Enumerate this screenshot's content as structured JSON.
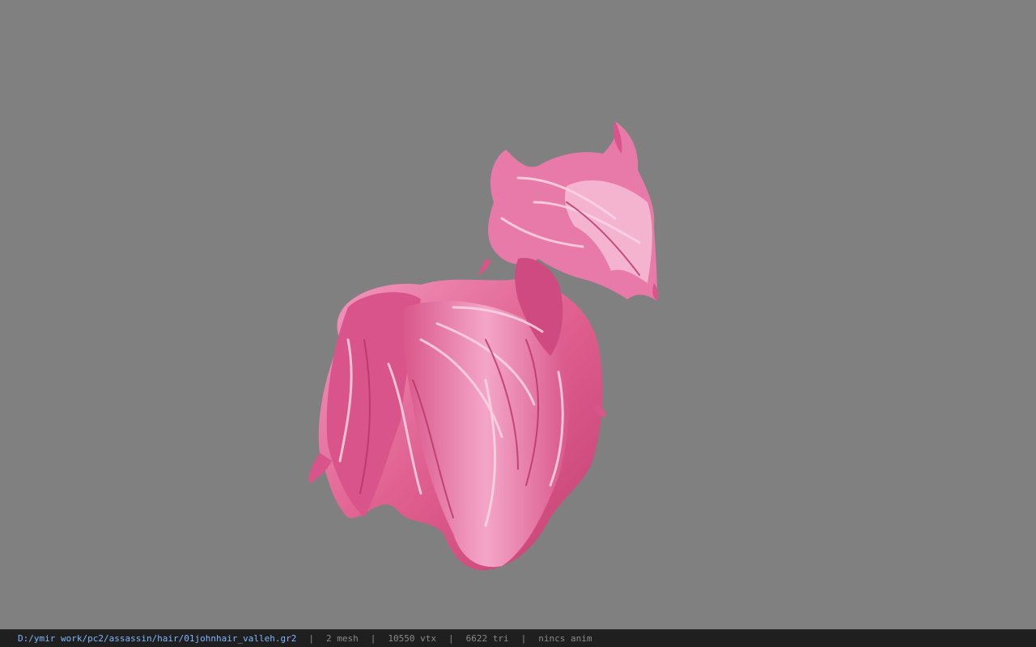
{
  "viewport": {
    "background": "#808080",
    "model": "pink-hair-mesh",
    "hair_colors": [
      "#e0608f",
      "#f08ab4",
      "#fbd6e6",
      "#c43f74"
    ]
  },
  "status_bar": {
    "file_path": "D:/ymir work/pc2/assassin/hair/01johnhair_valleh.gr2",
    "separator": "|",
    "mesh_count": "2 mesh",
    "vertex_count": "10550 vtx",
    "triangle_count": "6622 tri",
    "anim_status": "nincs anim",
    "path_color": "#7fb6ff",
    "text_color": "#8a8a8a",
    "background": "#1f1f1f"
  }
}
